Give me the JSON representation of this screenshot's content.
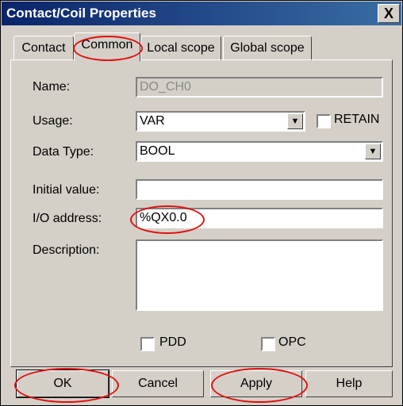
{
  "window": {
    "title": "Contact/Coil Properties",
    "close_glyph": "X"
  },
  "tabs": [
    {
      "label": "Contact",
      "active": false
    },
    {
      "label": "Common",
      "active": true
    },
    {
      "label": "Local scope",
      "active": false
    },
    {
      "label": "Global scope",
      "active": false
    }
  ],
  "form": {
    "name": {
      "label": "Name:",
      "value": "DO_CH0",
      "enabled": false
    },
    "usage": {
      "label": "Usage:",
      "value": "VAR"
    },
    "retain": {
      "label": "RETAIN",
      "checked": false
    },
    "data_type": {
      "label": "Data Type:",
      "value": "BOOL"
    },
    "initial_value": {
      "label": "Initial value:",
      "value": ""
    },
    "io_address": {
      "label": "I/O address:",
      "value": "%QX0.0"
    },
    "description": {
      "label": "Description:",
      "value": ""
    },
    "pdd": {
      "label": "PDD",
      "checked": false
    },
    "opc": {
      "label": "OPC",
      "checked": false
    }
  },
  "buttons": {
    "ok": "OK",
    "cancel": "Cancel",
    "apply": "Apply",
    "help": "Help"
  },
  "colors": {
    "annotation": "#e01010",
    "titlebar": "#0a246a",
    "dialog_bg": "#d4d0c8"
  }
}
